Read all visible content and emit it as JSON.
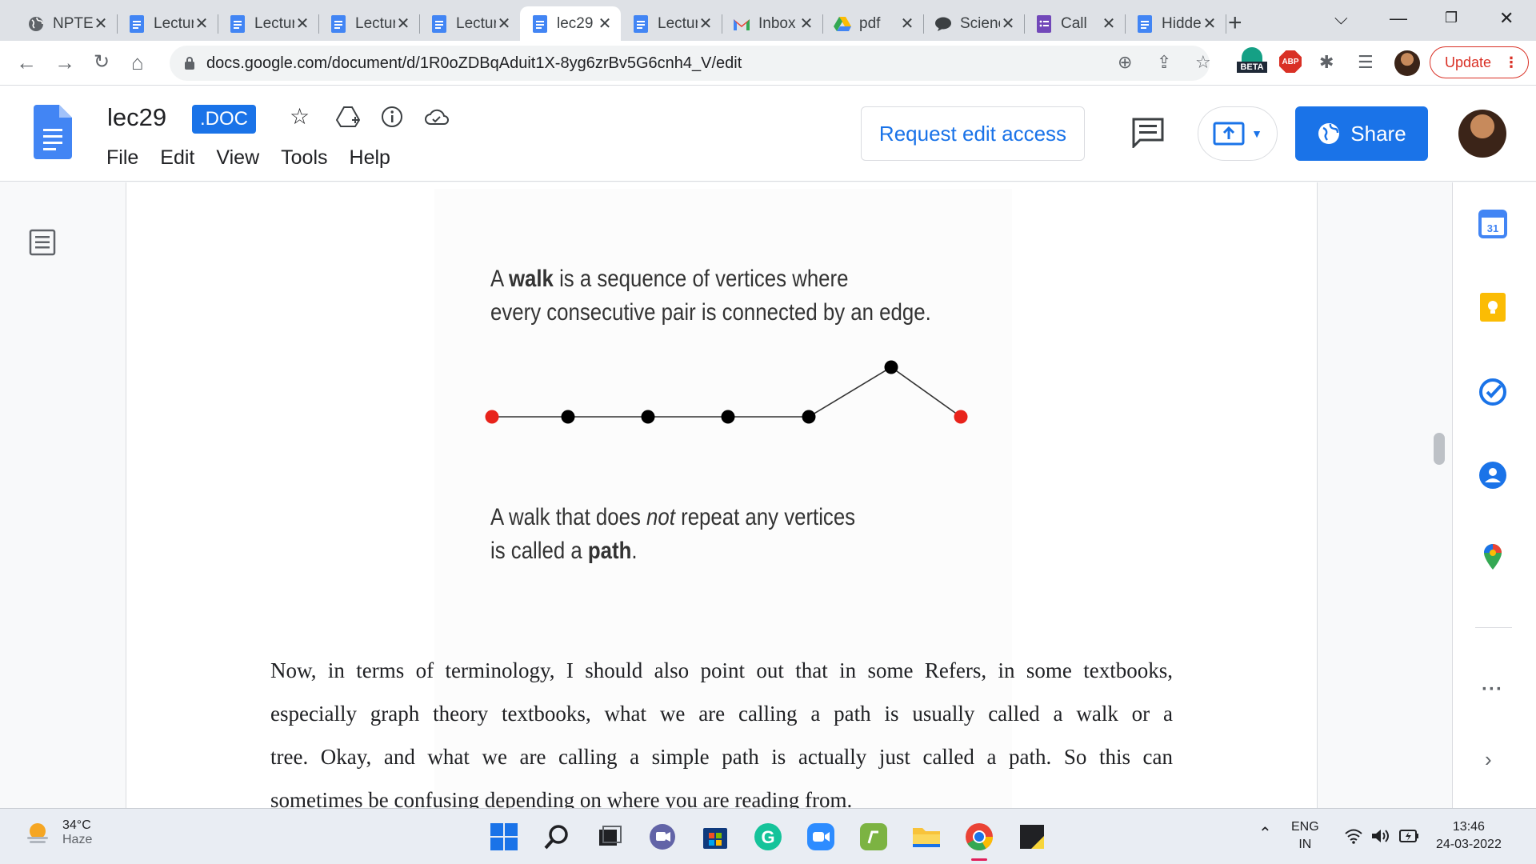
{
  "browser": {
    "tabs": [
      {
        "title": "NPTEL",
        "icon": "globe-icon"
      },
      {
        "title": "Lecture",
        "icon": "docs-icon"
      },
      {
        "title": "Lecture",
        "icon": "docs-icon"
      },
      {
        "title": "Lecture",
        "icon": "docs-icon"
      },
      {
        "title": "Lecture",
        "icon": "docs-icon"
      },
      {
        "title": "lec29",
        "icon": "docs-icon",
        "active": true
      },
      {
        "title": "Lecture",
        "icon": "docs-icon"
      },
      {
        "title": "Inbox",
        "icon": "gmail-icon"
      },
      {
        "title": "pdf",
        "icon": "drive-icon"
      },
      {
        "title": "Science",
        "icon": "chat-icon"
      },
      {
        "title": "Call",
        "icon": "forms-icon"
      },
      {
        "title": "Hidden",
        "icon": "docs-icon"
      }
    ],
    "url": "docs.google.com/document/d/1R0oZDBqAduit1X-8yg6zrBv5G6cnh4_V/edit",
    "update_label": "Update",
    "beta_label": "BETA",
    "abp_label": "ABP"
  },
  "docs": {
    "title": "lec29",
    "badge": ".DOC",
    "menu": [
      "File",
      "Edit",
      "View",
      "Tools",
      "Help"
    ],
    "request_access_label": "Request edit access",
    "share_label": "Share"
  },
  "document": {
    "slide_line1_pre": "A ",
    "slide_line1_bold": "walk",
    "slide_line1_post": " is a sequence of vertices where",
    "slide_line2": "every consecutive pair is connected by an edge.",
    "slide_line3_pre": "A walk that does ",
    "slide_line3_ital": "not",
    "slide_line3_post": " repeat any vertices",
    "slide_line4_pre": "is called a ",
    "slide_line4_bold": "path",
    "slide_line4_post": ".",
    "body_lines": [
      "Now, in terms of terminology, I should also point out that in some Refers, in some textbooks,",
      "especially graph theory textbooks, what we are calling a path is usually called a walk or a",
      "tree. Okay, and what we are calling a simple path is actually just called a path. So this can",
      "sometimes be confusing depending on where you are reading from."
    ]
  },
  "taskbar": {
    "temperature": "34°C",
    "weather": "Haze",
    "lang_top": "ENG",
    "lang_bottom": "IN",
    "time": "13:46",
    "date": "24-03-2022"
  }
}
